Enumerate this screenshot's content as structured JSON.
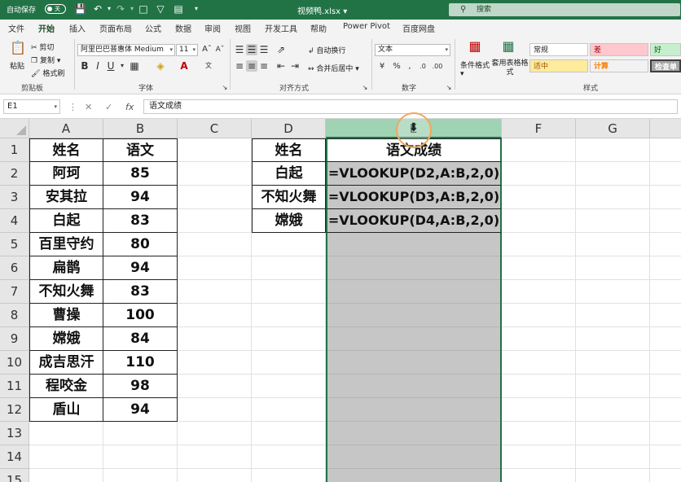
{
  "titlebar": {
    "autosave_label": "自动保存",
    "autosave_state": "关",
    "filename": "视频鸭.xlsx",
    "search_placeholder": "搜索"
  },
  "menu": {
    "tabs": [
      "文件",
      "开始",
      "插入",
      "页面布局",
      "公式",
      "数据",
      "审阅",
      "视图",
      "开发工具",
      "帮助",
      "Power Pivot",
      "百度网盘"
    ],
    "active": "开始"
  },
  "ribbon": {
    "paste": "粘贴",
    "cut": "剪切",
    "copy": "复制",
    "format_painter": "格式刷",
    "clipboard_label": "剪贴板",
    "font_name": "阿里巴巴普惠体 Medium",
    "font_size": "11",
    "bold": "B",
    "italic": "I",
    "underline": "U",
    "font_label": "字体",
    "wrap_text": "自动换行",
    "merge_center": "合并后居中",
    "alignment_label": "对齐方式",
    "number_format": "文本",
    "number_label": "数字",
    "conditional_format": "条件格式",
    "format_as_table": "套用表格格式",
    "styles": [
      {
        "name": "常规",
        "bg": "#ffffff",
        "fg": "#222222"
      },
      {
        "name": "差",
        "bg": "#ffc7ce",
        "fg": "#9c0006"
      },
      {
        "name": "好",
        "bg": "#c6efce",
        "fg": "#006100"
      },
      {
        "name": "适中",
        "bg": "#ffeb9c",
        "fg": "#9c5700"
      },
      {
        "name": "计算",
        "bg": "#f2f2f2",
        "fg": "#fa7d00"
      },
      {
        "name": "检查单",
        "bg": "#a5a5a5",
        "fg": "#ffffff"
      }
    ],
    "styles_label": "样式"
  },
  "formula_bar": {
    "name_box": "E1",
    "content": "语文成绩"
  },
  "grid": {
    "columns": [
      "A",
      "B",
      "C",
      "D",
      "E",
      "F",
      "G"
    ],
    "selected_column": "E",
    "rows": [
      "1",
      "2",
      "3",
      "4",
      "5",
      "6",
      "7",
      "8",
      "9",
      "10",
      "11",
      "12",
      "13",
      "14",
      "15"
    ],
    "table1": {
      "headers": [
        "姓名",
        "语文"
      ],
      "rows": [
        [
          "阿珂",
          "85"
        ],
        [
          "安其拉",
          "94"
        ],
        [
          "白起",
          "83"
        ],
        [
          "百里守约",
          "80"
        ],
        [
          "扁鹊",
          "94"
        ],
        [
          "不知火舞",
          "83"
        ],
        [
          "曹操",
          "100"
        ],
        [
          "嫦娥",
          "84"
        ],
        [
          "成吉思汗",
          "110"
        ],
        [
          "程咬金",
          "98"
        ],
        [
          "盾山",
          "94"
        ]
      ]
    },
    "table2": {
      "headers": [
        "姓名",
        "语文成绩"
      ],
      "rows": [
        [
          "白起",
          "=VLOOKUP(D2,A:B,2,0)"
        ],
        [
          "不知火舞",
          "=VLOOKUP(D3,A:B,2,0)"
        ],
        [
          "嫦娥",
          "=VLOOKUP(D4,A:B,2,0)"
        ]
      ]
    }
  },
  "colors": {
    "brand": "#217346",
    "selected_column": "#c6c6c6",
    "cursor_ring": "#f2a65a"
  }
}
